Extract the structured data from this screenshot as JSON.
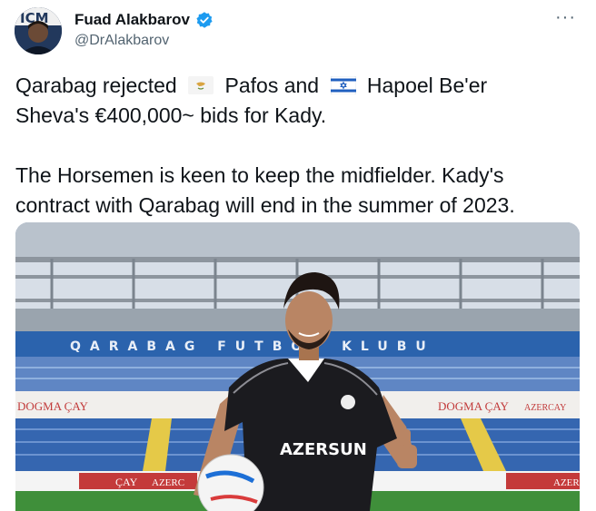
{
  "author": {
    "display_name": "Fuad Alakbarov",
    "handle": "@DrAlakbarov",
    "verified": true,
    "avatar_icon": "profile-photo"
  },
  "menu": {
    "more_label": "···"
  },
  "tweet": {
    "line1_a": "Qarabag rejected",
    "flag1_icon": "cyprus-flag",
    "line1_b": "Pafos and",
    "flag2_icon": "israel-flag",
    "line1_c": "Hapoel Be'er",
    "line2": "Sheva's €400,000~ bids for Kady.",
    "line3": "The Horsemen is keen to keep the midfielder. Kady's",
    "line4": "contract with Qarabag will end in the summer of 2023."
  },
  "media": {
    "stadium_sign": "QARABAG FUTBOL KLUBU",
    "ad_banner_1": "DOGMA ÇAY",
    "ad_banner_2": "DOGMA ÇAY",
    "ad_banner_3": "AZERCAY",
    "ad_banner_4": "ÇAY",
    "ad_banner_5": "AZERC",
    "ad_banner_6": "AZER",
    "jersey_sponsor": "AZERSUN",
    "colors": {
      "sky": "#dfe6ee",
      "seats": "#2a5ea8",
      "grass": "#3f8f3a",
      "jersey": "#1b1b1f"
    }
  }
}
